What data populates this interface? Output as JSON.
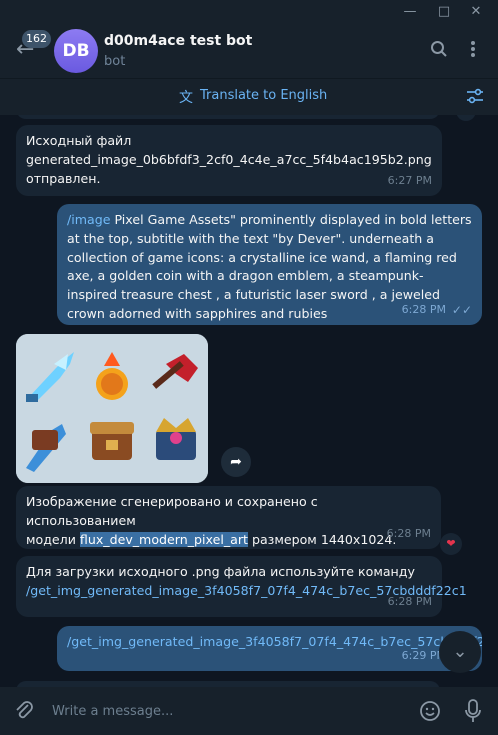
{
  "header": {
    "badge": "162",
    "avatar_initials": "DB",
    "title": "d00m4ace test bot",
    "status": "bot"
  },
  "translate_bar": {
    "label": "Translate to English"
  },
  "partial_time_top": "6:27 PM",
  "messages": [
    {
      "line1": "Исходный файл",
      "line2": "generated_image_0b6bfdf3_2cf0_4c4e_a7cc_5f4b4ac195b2.png",
      "line3": "отправлен.",
      "time": "6:27 PM"
    },
    {
      "command": "/image",
      "text": " Pixel Game Assets\" prominently displayed in bold letters at the top, subtitle with the text \"by Dever\". underneath a collection of game icons: a crystalline ice wand, a flaming red axe, a golden coin with a dragon emblem, a steampunk-inspired treasure chest , a futuristic laser sword , a jeweled crown adorned with sapphires and rubies",
      "time": "6:28 PM"
    },
    {
      "line1": "Изображение сгенерировано и сохранено с использованием",
      "prefix": "модели ",
      "model": "flux_dev_modern_pixel_art",
      "suffix": " размером 1440x1024.",
      "time": "6:28 PM"
    },
    {
      "line1": "Для загрузки исходного .png файла используйте команду",
      "command": "/get_img_generated_image_3f4058f7_07f4_474c_b7ec_57cbdddf22c1",
      "time": "6:28 PM"
    },
    {
      "command": "/get_img_generated_image_3f4058f7_07f4_474c_b7ec_57cbdddf22c1",
      "time": "6:29 PM"
    }
  ],
  "reaction": "❤",
  "composer": {
    "placeholder": "Write a message..."
  }
}
